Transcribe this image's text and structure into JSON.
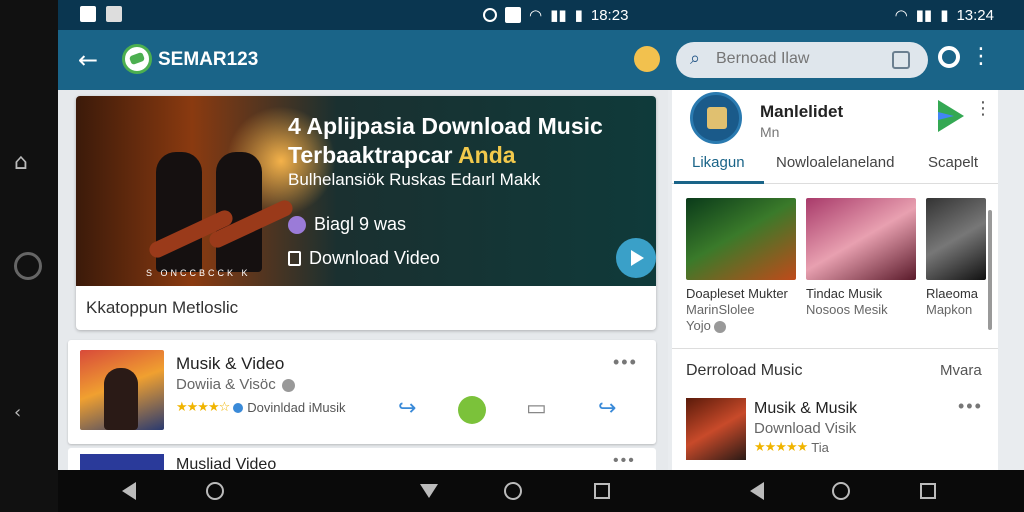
{
  "status_bar": {
    "time_left": "18:23",
    "time_right": "13:24"
  },
  "app_bar": {
    "title": "SEMAR123",
    "search_placeholder": "Bernoad Ilaw"
  },
  "hero": {
    "title_line1": "4 Aplijpasia Download Music",
    "title_line2_prefix": "Terbaaktrapcar ",
    "title_line2_accent": "Anda",
    "subtitle": "Bulhelansiök Ruskas Edaırl Makk",
    "meta": "Biagl 9 was",
    "download_label": "Download Video",
    "band_label": "S ONCCBCCK K",
    "caption": "Kkatoppun Metloslic"
  },
  "list_items": [
    {
      "title": "Musik & Video",
      "subtitle": "Dowiia & Visöc",
      "rating_stars": "★★★★☆",
      "rating_label": "Dovinldad iMusik"
    },
    {
      "title": "Musliad Video"
    }
  ],
  "right_panel": {
    "name": "Manlelidet",
    "sub": "Mn",
    "tabs": [
      "Likagun",
      "Nowloalelaneland",
      "Scapelt"
    ],
    "tiles": [
      {
        "title": "Doapleset Mukter",
        "sub": "MarinSlolee",
        "sub2": "Yojo"
      },
      {
        "title": "Tindac Musik",
        "sub": "Nosoos Mesik",
        "sub2": ""
      },
      {
        "title": "Rlaeoma",
        "sub": "Mapkon",
        "sub2": ""
      }
    ],
    "section_title": "Derroload Music",
    "section_more": "Mvara",
    "item": {
      "title": "Musik & Musik",
      "sub": "Download Visik",
      "rating_stars": "★★★★★",
      "rating_label": "Tia"
    }
  },
  "colors": {
    "status_bar": "#0a3650",
    "app_bar": "#1a6488",
    "accent": "#3aa0c8",
    "star": "#f0b400"
  },
  "icons": [
    "back-arrow-icon",
    "search-icon",
    "more-vert-icon",
    "play-icon",
    "share-icon",
    "whatsapp-icon",
    "comment-icon",
    "star-icon",
    "google-play-icon"
  ]
}
